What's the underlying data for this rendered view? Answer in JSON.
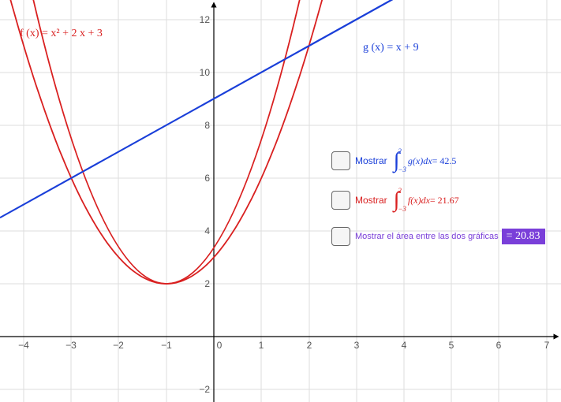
{
  "chart_data": {
    "type": "line",
    "title": "",
    "xlabel": "",
    "ylabel": "",
    "xlim": [
      -4.5,
      7.3
    ],
    "ylim": [
      -2.5,
      12.7
    ],
    "x_ticks": [
      -4,
      -3,
      -2,
      -1,
      0,
      1,
      2,
      3,
      4,
      5,
      6,
      7
    ],
    "y_ticks": [
      -2,
      2,
      4,
      6,
      8,
      10,
      12
    ],
    "grid": true,
    "series": [
      {
        "name": "f(x) = x² + 2x + 3",
        "color": "#d92020",
        "type": "parabola",
        "x": [
          -4,
          -3,
          -2,
          -1,
          0,
          1,
          2,
          3
        ],
        "y": [
          11,
          6,
          3,
          2,
          3,
          6,
          11,
          18
        ]
      },
      {
        "name": "g(x) = x + 9",
        "color": "#1a3fd9",
        "type": "line",
        "x": [
          -4.5,
          7.3
        ],
        "y": [
          4.5,
          16.3
        ]
      }
    ],
    "intersections": [
      {
        "x": -3,
        "y": 6
      },
      {
        "x": 2,
        "y": 11
      }
    ]
  },
  "labels": {
    "f_label": "f (x)  = x² + 2 x + 3",
    "g_label": "g (x)  = x + 9"
  },
  "controls": {
    "show_g_integral": {
      "label": "Mostrar",
      "lower": "−3",
      "upper": "2",
      "integrand": "g(x)dx",
      "equals": " = 42.5",
      "color": "#1a3fd9"
    },
    "show_f_integral": {
      "label": "Mostrar",
      "lower": "−3",
      "upper": "2",
      "integrand": "f(x)dx",
      "equals": " = 21.67",
      "color": "#d92020"
    },
    "show_area": {
      "label": "Mostrar el área entre las dos gráficas",
      "value": "= 20.83",
      "color": "#7a3fd9"
    }
  }
}
